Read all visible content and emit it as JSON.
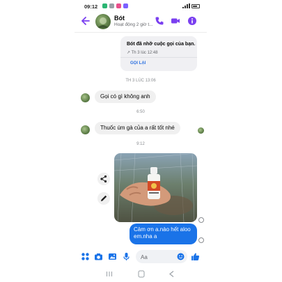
{
  "status_bar": {
    "time": "09:12",
    "colors": {
      "dot1": "#2bb673",
      "dot2": "#9aa0a6",
      "dot3": "#e94f8b",
      "dot4": "#7b61ff"
    }
  },
  "header": {
    "contact_name": "Bót",
    "status_text": "Hoạt động 2 giờ t...",
    "accent_color": "#7a3ff0"
  },
  "messages": {
    "missed_call": {
      "title": "Bót đã nhỡ cuộc gọi của bạn.",
      "meta": "↗ Th 3 lúc 12:48",
      "callback_label": "GỌI LẠI"
    },
    "timestamp_1": "TH 3 LÚC 13:06",
    "incoming_1": "Gọi có gì không anh",
    "timestamp_2": "6:50",
    "incoming_2": "Thuốc úm gà của a rất tốt nhé",
    "timestamp_3": "9:12",
    "photo": {
      "icon": "photo-medicine-bottle-in-hand"
    },
    "outgoing_1": "Cảm ơn a.nào hết aloo em.nha a"
  },
  "composer": {
    "placeholder": "Aa",
    "icons": [
      "apps-icon",
      "camera-icon",
      "gallery-icon",
      "mic-icon",
      "emoji-icon",
      "like-icon"
    ]
  },
  "nav_bar": {
    "icons": [
      "recent-apps-icon",
      "home-icon",
      "back-icon"
    ]
  }
}
